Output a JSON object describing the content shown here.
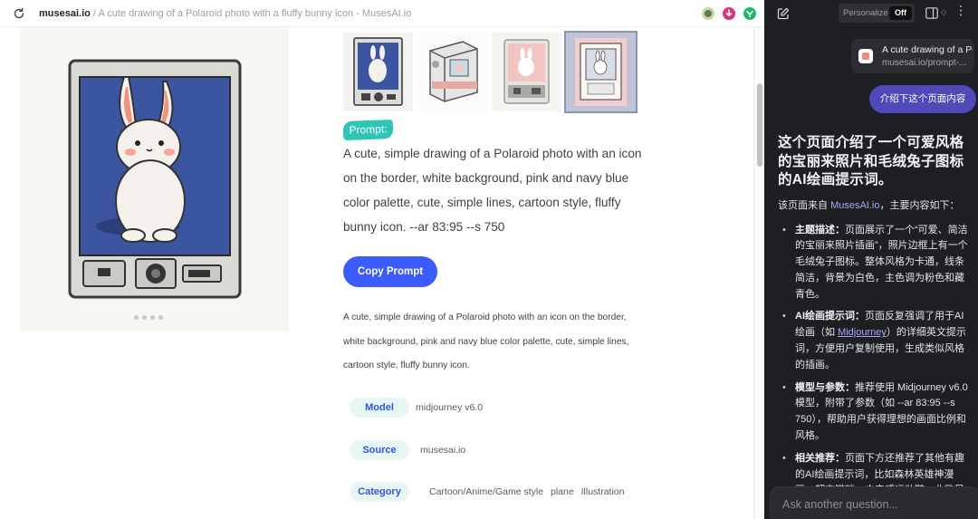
{
  "browser": {
    "host": "musesai.io",
    "separator": "/",
    "page_title": "A cute drawing of a Polaroid photo with a fluffy bunny icon - MusesAI.io",
    "extensions": [
      {
        "name": "extension-1",
        "color": "#5e7d4d"
      },
      {
        "name": "extension-2",
        "color": "#d6337a"
      },
      {
        "name": "extension-3",
        "color": "#1fb86a"
      }
    ]
  },
  "page": {
    "prompt_tag": "Prompt:",
    "prompt_text": "A cute, simple drawing of a Polaroid photo with an icon on the border, white background, pink and navy blue color palette, cute, simple lines, cartoon style, fluffy bunny icon. --ar 83:95 --s 750",
    "copy_button": "Copy Prompt",
    "description": "A cute, simple drawing of a Polaroid photo with an icon on the border, white background, pink and navy blue color palette, cute, simple lines, cartoon style, fluffy bunny icon.",
    "meta": [
      {
        "label": "Model",
        "values": [
          "midjourney v6.0"
        ]
      },
      {
        "label": "Source",
        "values": [
          "musesai.io"
        ]
      },
      {
        "label": "Category",
        "values": [
          "Cartoon/Anime/Game style",
          "plane",
          "Illustration"
        ]
      }
    ],
    "carousel_dots": 4
  },
  "sidebar": {
    "personalize_label": "Personalize",
    "personalize_state": "Off",
    "link_card": {
      "title": "A cute drawing of a Polaroid photo...",
      "url": "musesai.io/prompt-..."
    },
    "user_message": "介绍下这个页面内容",
    "answer": {
      "title": "这个页面介绍了一个可爱风格的宝丽来照片和毛绒兔子图标的AI绘画提示词。",
      "intro_prefix": "该页面来自 ",
      "intro_link": "MusesAI.io",
      "intro_suffix": "，主要内容如下：",
      "items": [
        {
          "head": "主题描述：",
          "text": "页面展示了一个“可爱、简洁的宝丽来照片插画”，照片边框上有一个毛绒兔子图标。整体风格为卡通，线条简洁，背景为白色，主色调为粉色和藏青色。"
        },
        {
          "head": "AI绘画提示词：",
          "text_pre": "页面反复强调了用于AI绘画（如 ",
          "link": "Midjourney",
          "text_post": "）的详细英文提示词，方便用户复制使用，生成类似风格的插画。"
        },
        {
          "head": "模型与参数：",
          "text": "推荐使用 Midjourney v6.0 模型，附带了参数（如 --ar 83:95 --s 750），帮助用户获得理想的画面比例和风格。"
        },
        {
          "head": "相关推荐：",
          "text": "页面下方还推荐了其他有趣的AI绘画提示词，比如森林英雄神漫画、超市猫咪、未来感运动鞋、北欧风格等。"
        }
      ]
    },
    "input_placeholder": "Ask another question..."
  }
}
